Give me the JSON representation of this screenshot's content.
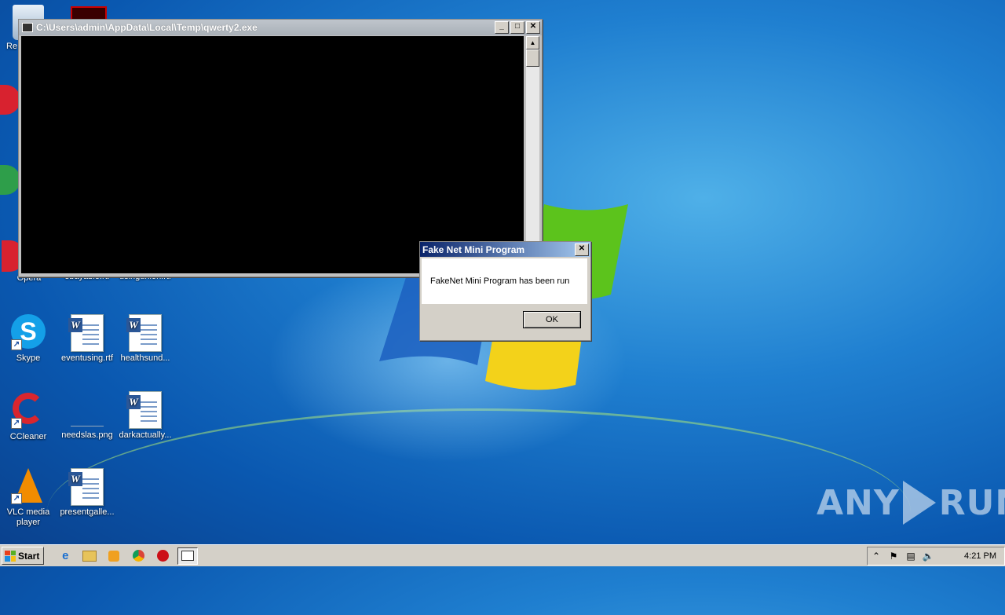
{
  "console_window": {
    "title": "C:\\Users\\admin\\AppData\\Local\\Temp\\qwerty2.exe",
    "buttons": {
      "minimize": "_",
      "maximize": "□",
      "close": "✕"
    }
  },
  "message_box": {
    "title": "Fake Net Mini Program",
    "message": "FakeNet Mini Program has been run",
    "ok_label": "OK",
    "close": "✕"
  },
  "desktop": {
    "icons": [
      {
        "label": "Re",
        "icon": "recycle-bin-icon"
      },
      {
        "label": "Opera",
        "icon": "opera-icon"
      },
      {
        "label": "ebayable.rtf",
        "icon": "word-doc-icon"
      },
      {
        "label": "usingunion.rtf",
        "icon": "word-doc-icon"
      },
      {
        "label": "Skype",
        "icon": "skype-icon"
      },
      {
        "label": "eventusing.rtf",
        "icon": "word-doc-icon"
      },
      {
        "label": "healthsund...",
        "icon": "word-doc-icon"
      },
      {
        "label": "CCleaner",
        "icon": "ccleaner-icon"
      },
      {
        "label": "needslas.png",
        "icon": "image-icon"
      },
      {
        "label": "darkactually...",
        "icon": "word-doc-icon"
      },
      {
        "label": "VLC media player",
        "icon": "vlc-icon"
      },
      {
        "label": "presentgalle...",
        "icon": "word-doc-icon"
      }
    ]
  },
  "taskbar": {
    "start_label": "Start",
    "quick_launch": [
      "ie-icon",
      "explorer-icon",
      "media-player-icon",
      "chrome-icon",
      "opera-icon"
    ],
    "clock": "4:21 PM"
  },
  "watermark": {
    "left": "ANY",
    "right": "RUN"
  }
}
